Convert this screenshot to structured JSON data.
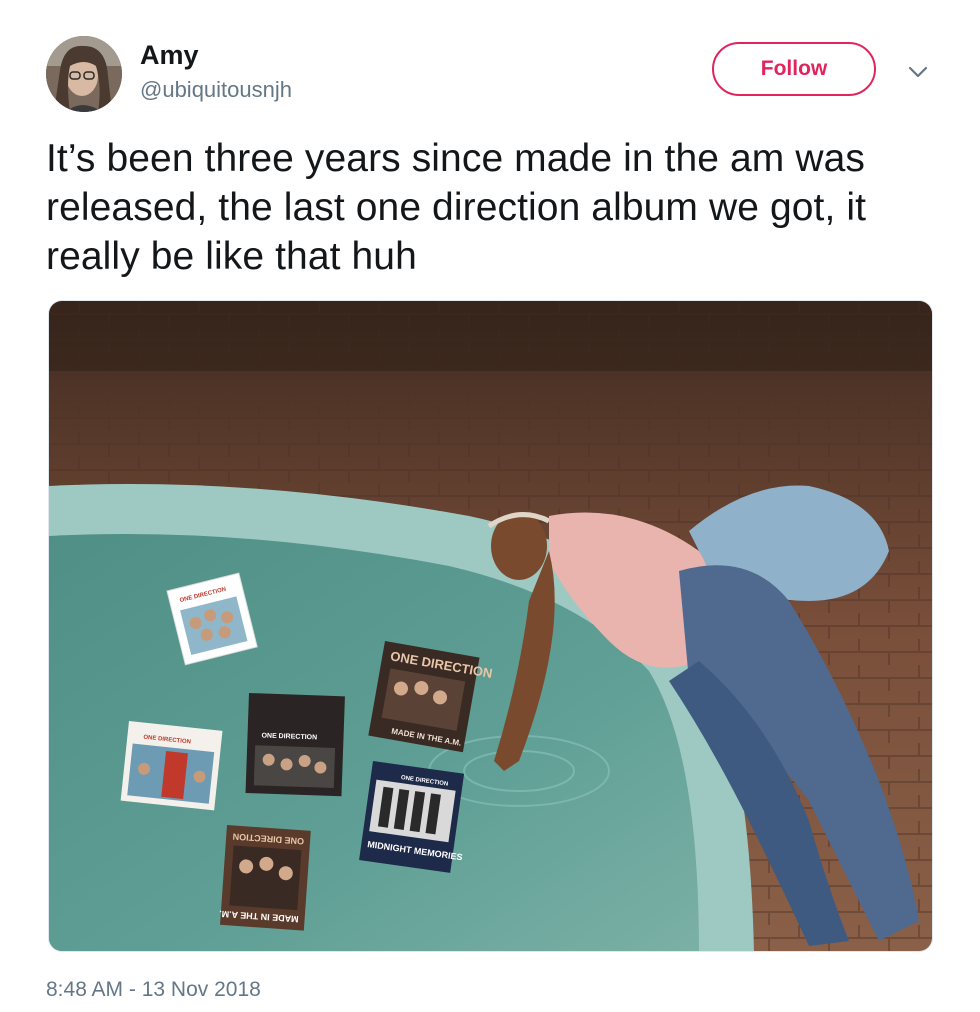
{
  "tweet": {
    "author_name": "Amy",
    "author_handle": "@ubiquitousnjh",
    "follow_label": "Follow",
    "text": "It’s been three years since made in the am was released, the last one direction album we got, it really be like that huh",
    "timestamp": "8:48 AM - 13 Nov 2018"
  },
  "icons": {
    "avatar": "avatar-photo",
    "menu": "chevron-down-icon"
  },
  "media": {
    "album_covers": {
      "up_all_night": "ONE DIRECTION",
      "take_me_home": "ONE DIRECTION",
      "four_top": "ONE DIRECTION",
      "four_bottom": "MADE IN THE A.M.",
      "banner": "ONE DIRECTION",
      "midnight_top": "ONE DIRECTION",
      "midnight_title": "MIDNIGHT MEMORIES",
      "made_top": "ONE DIRECTION",
      "made_bottom": "MADE IN THE A.M."
    }
  },
  "colors": {
    "follow": "#e0245e",
    "secondary_text": "#657786",
    "primary_text": "#14171a"
  }
}
